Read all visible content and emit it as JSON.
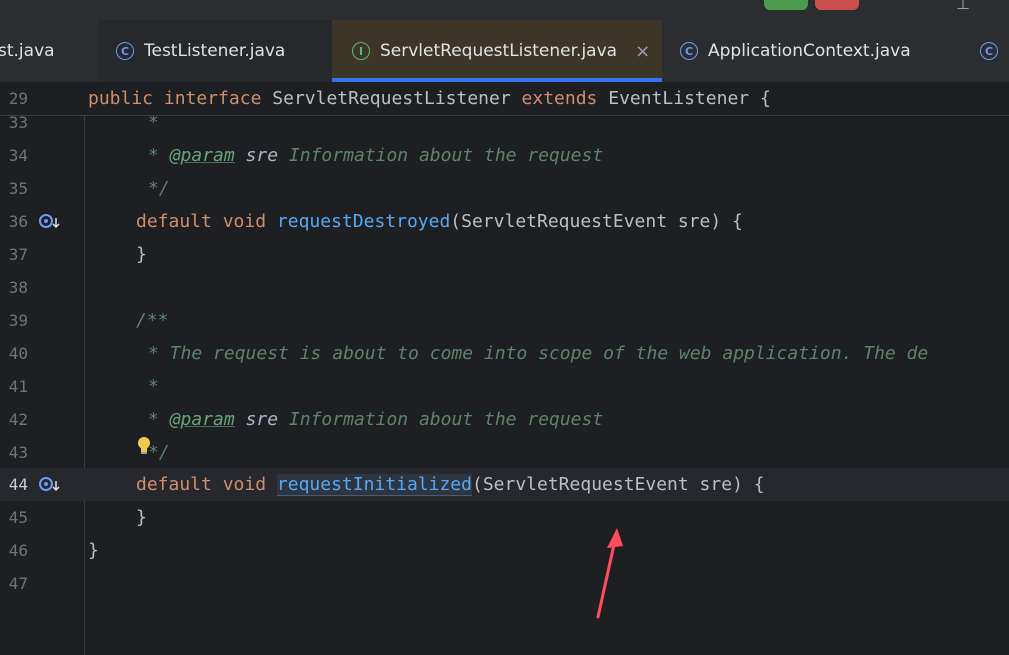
{
  "tabs": [
    {
      "label": "st.java",
      "icon": "",
      "active": false
    },
    {
      "label": "TestListener.java",
      "icon": "class-icon",
      "active": false
    },
    {
      "label": "ServletRequestListener.java",
      "icon": "interface-icon",
      "active": true
    },
    {
      "label": "ApplicationContext.java",
      "icon": "class-icon",
      "active": false
    },
    {
      "label": "",
      "icon": "class-icon",
      "active": false
    }
  ],
  "icon_letters": {
    "class": "C",
    "interface": "I"
  },
  "close_glyph": "×",
  "sticky_header": {
    "line": "29",
    "kw_public": "public",
    "kw_interface": "interface",
    "name": "ServletRequestListener",
    "kw_extends": "extends",
    "parent": "EventListener",
    "brace": "{"
  },
  "lines": {
    "l33": {
      "num": "33",
      "text": "*"
    },
    "l34": {
      "num": "34",
      "star": "*",
      "tag": "@param",
      "param": "sre",
      "desc": "Information about the request"
    },
    "l35": {
      "num": "35",
      "text": "*/"
    },
    "l36": {
      "num": "36",
      "kw1": "default",
      "kw2": "void",
      "method": "requestDestroyed",
      "args": "(ServletRequestEvent sre) {"
    },
    "l37": {
      "num": "37",
      "text": "}"
    },
    "l38": {
      "num": "38"
    },
    "l39": {
      "num": "39",
      "text": "/**"
    },
    "l40": {
      "num": "40",
      "text": "* The request is about to come into scope of the web application. The de"
    },
    "l41": {
      "num": "41",
      "text": "*"
    },
    "l42": {
      "num": "42",
      "star": "*",
      "tag": "@param",
      "param": "sre",
      "desc": "Information about the request"
    },
    "l43": {
      "num": "43",
      "text": "*/"
    },
    "l44": {
      "num": "44",
      "kw1": "default",
      "kw2": "void",
      "method": "requestInitialized",
      "args": "(ServletRequestEvent sre) {"
    },
    "l45": {
      "num": "45",
      "text": "}"
    },
    "l46": {
      "num": "46",
      "text": "}"
    },
    "l47": {
      "num": "47"
    }
  },
  "current_line": "44",
  "colors": {
    "keyword": "#cf8e6d",
    "method": "#56a8f5",
    "comment": "#5f826b",
    "text": "#bcbec4",
    "annotation_arrow": "#ff4d5e"
  }
}
